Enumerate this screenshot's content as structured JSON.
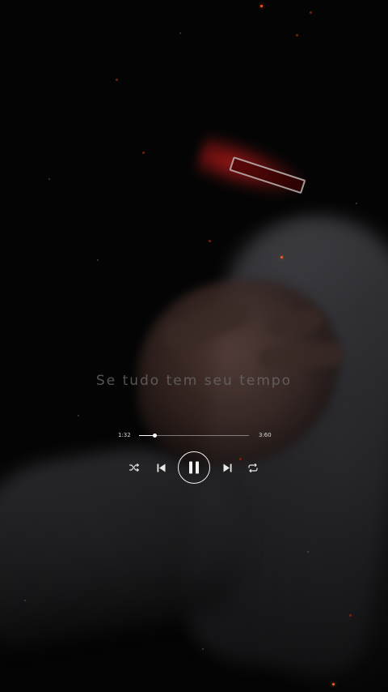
{
  "lyrics": {
    "line": "Se tudo tem seu tempo"
  },
  "player": {
    "elapsed": "1:32",
    "total": "3:60",
    "progress_fraction": 0.14,
    "controls": {
      "shuffle_icon": "shuffle-icon",
      "previous_icon": "skip-previous-icon",
      "play_pause_icon": "pause-icon",
      "next_icon": "skip-next-icon",
      "repeat_icon": "repeat-icon"
    }
  },
  "colors": {
    "background": "#000000",
    "controls": "#e8e8e8",
    "lyrics_text": "#6e6e6e",
    "spark": "#ff5a1a",
    "dash_light": "#dc1e1e"
  }
}
